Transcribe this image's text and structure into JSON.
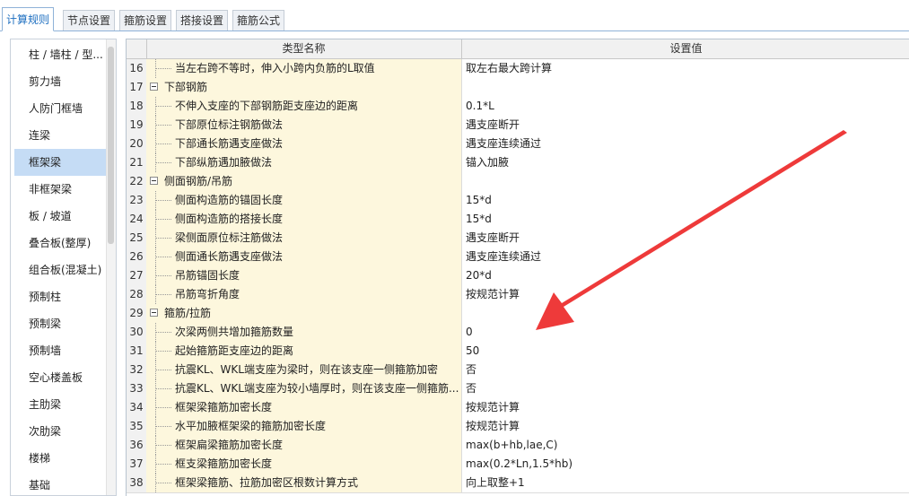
{
  "tabs": [
    {
      "label": "计算规则",
      "active": true
    },
    {
      "label": "节点设置",
      "active": false
    },
    {
      "label": "箍筋设置",
      "active": false
    },
    {
      "label": "搭接设置",
      "active": false
    },
    {
      "label": "箍筋公式",
      "active": false
    }
  ],
  "sidebar": {
    "items": [
      {
        "label": "柱 / 墙柱 / 型..."
      },
      {
        "label": "剪力墙"
      },
      {
        "label": "人防门框墙"
      },
      {
        "label": "连梁"
      },
      {
        "label": "框架梁",
        "selected": true
      },
      {
        "label": "非框架梁"
      },
      {
        "label": "板 / 坡道"
      },
      {
        "label": "叠合板(整厚)"
      },
      {
        "label": "组合板(混凝土)"
      },
      {
        "label": "预制柱"
      },
      {
        "label": "预制梁"
      },
      {
        "label": "预制墙"
      },
      {
        "label": "空心楼盖板"
      },
      {
        "label": "主肋梁"
      },
      {
        "label": "次肋梁"
      },
      {
        "label": "楼梯"
      },
      {
        "label": "基础"
      }
    ]
  },
  "grid": {
    "header_type": "类型名称",
    "header_value": "设置值",
    "rows": [
      {
        "num": "16",
        "type": "当左右跨不等时，伸入小跨内负筋的L取值",
        "value": "取左右最大跨计算",
        "group": false
      },
      {
        "num": "17",
        "type": "下部钢筋",
        "value": "",
        "group": true
      },
      {
        "num": "18",
        "type": "不伸入支座的下部钢筋距支座边的距离",
        "value": "0.1*L",
        "group": false
      },
      {
        "num": "19",
        "type": "下部原位标注钢筋做法",
        "value": "遇支座断开",
        "group": false
      },
      {
        "num": "20",
        "type": "下部通长筋遇支座做法",
        "value": "遇支座连续通过",
        "group": false
      },
      {
        "num": "21",
        "type": "下部纵筋遇加腋做法",
        "value": "锚入加腋",
        "group": false
      },
      {
        "num": "22",
        "type": "侧面钢筋/吊筋",
        "value": "",
        "group": true
      },
      {
        "num": "23",
        "type": "侧面构造筋的锚固长度",
        "value": "15*d",
        "group": false
      },
      {
        "num": "24",
        "type": "侧面构造筋的搭接长度",
        "value": "15*d",
        "group": false
      },
      {
        "num": "25",
        "type": "梁侧面原位标注筋做法",
        "value": "遇支座断开",
        "group": false
      },
      {
        "num": "26",
        "type": "侧面通长筋遇支座做法",
        "value": "遇支座连续通过",
        "group": false
      },
      {
        "num": "27",
        "type": "吊筋锚固长度",
        "value": "20*d",
        "group": false
      },
      {
        "num": "28",
        "type": "吊筋弯折角度",
        "value": "按规范计算",
        "group": false
      },
      {
        "num": "29",
        "type": "箍筋/拉筋",
        "value": "",
        "group": true
      },
      {
        "num": "30",
        "type": "次梁两侧共增加箍筋数量",
        "value": "0",
        "group": false
      },
      {
        "num": "31",
        "type": "起始箍筋距支座边的距离",
        "value": "50",
        "group": false
      },
      {
        "num": "32",
        "type": "抗震KL、WKL端支座为梁时，则在该支座一侧箍筋加密",
        "value": "否",
        "group": false
      },
      {
        "num": "33",
        "type": "抗震KL、WKL端支座为较小墙厚时，则在该支座一侧箍筋...",
        "value": "否",
        "group": false
      },
      {
        "num": "34",
        "type": "框架梁箍筋加密长度",
        "value": "按规范计算",
        "group": false
      },
      {
        "num": "35",
        "type": "水平加腋框架梁的箍筋加密长度",
        "value": "按规范计算",
        "group": false
      },
      {
        "num": "36",
        "type": "框架扁梁箍筋加密长度",
        "value": "max(b+hb,lae,C)",
        "group": false
      },
      {
        "num": "37",
        "type": "框支梁箍筋加密长度",
        "value": "max(0.2*Ln,1.5*hb)",
        "group": false
      },
      {
        "num": "38",
        "type": "框架梁箍筋、拉筋加密区根数计算方式",
        "value": "向上取整+1",
        "group": false
      }
    ]
  },
  "colors": {
    "arrow": "#ee3a3a",
    "active_tab_text": "#1e6fc0",
    "selected_item": "#c5dcf5",
    "type_cell_bg": "#fdf7dd"
  }
}
